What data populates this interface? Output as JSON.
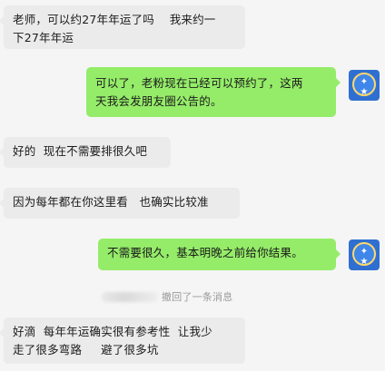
{
  "messages": [
    {
      "side": "left",
      "lines": [
        "老师，可以约27年年运了吗    我来约一",
        "下27年年运"
      ]
    },
    {
      "side": "right",
      "lines": [
        "可以了，老粉现在已经可以预约了，这两",
        "天我会发朋友圈公告的。"
      ]
    },
    {
      "side": "left",
      "lines": [
        "好的  现在不需要排很久吧"
      ]
    },
    {
      "side": "left",
      "lines": [
        "因为每年都在你这里看   也确实比较准"
      ]
    },
    {
      "side": "right",
      "lines": [
        "不需要很久，基本明晚之前给你结果。"
      ]
    },
    {
      "side": "left",
      "lines": [
        "好滴  每年年运确实很有参考性  让我少",
        "走了很多弯路     避了很多坑"
      ]
    }
  ],
  "recall_notice": "撤回了一条消息",
  "avatar": {
    "icon": "brand-logo-icon",
    "color": "#2f6fd1"
  }
}
